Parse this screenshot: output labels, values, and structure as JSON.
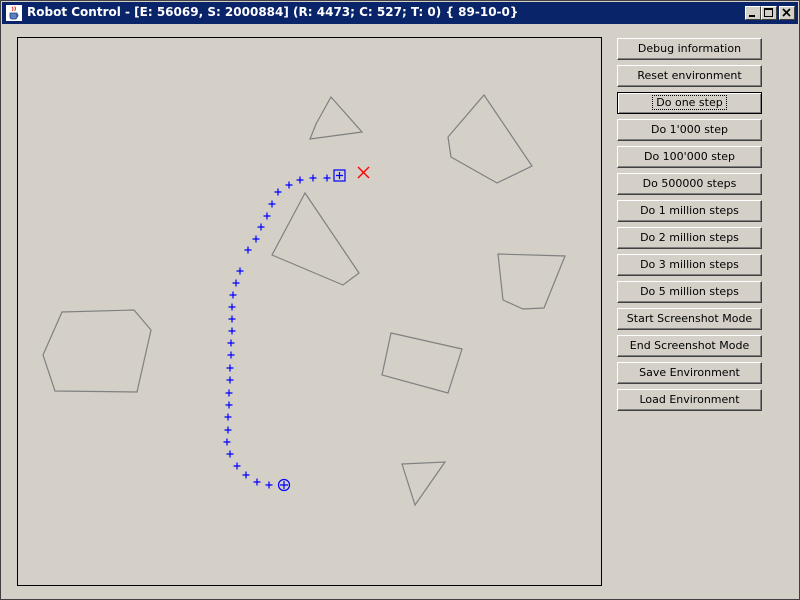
{
  "window": {
    "title": "Robot Control - [E: 56069, S: 2000884] (R: 4473; C: 527; T: 0) { 89-10-0}"
  },
  "buttons": [
    {
      "label": "Debug information"
    },
    {
      "label": "Reset environment"
    },
    {
      "label": "Do one step"
    },
    {
      "label": "Do 1'000 step"
    },
    {
      "label": "Do 100'000 step"
    },
    {
      "label": "Do 500000 steps"
    },
    {
      "label": "Do 1 million steps"
    },
    {
      "label": "Do 2 million steps"
    },
    {
      "label": "Do 3 million steps"
    },
    {
      "label": "Do 5 million steps"
    },
    {
      "label": "Start Screenshot Mode"
    },
    {
      "label": "End Screenshot Mode"
    },
    {
      "label": "Save Environment"
    },
    {
      "label": "Load Environment"
    }
  ],
  "colors": {
    "titlebar": "#0a246a",
    "path": "#0000ff",
    "target": "#ff0000",
    "obstacle": "#808080",
    "background": "#d4d0c8"
  },
  "icons": [
    "java-cup-icon",
    "minimize-icon",
    "maximize-icon",
    "close-icon",
    "start-marker-icon",
    "robot-marker-icon",
    "target-x-icon"
  ]
}
